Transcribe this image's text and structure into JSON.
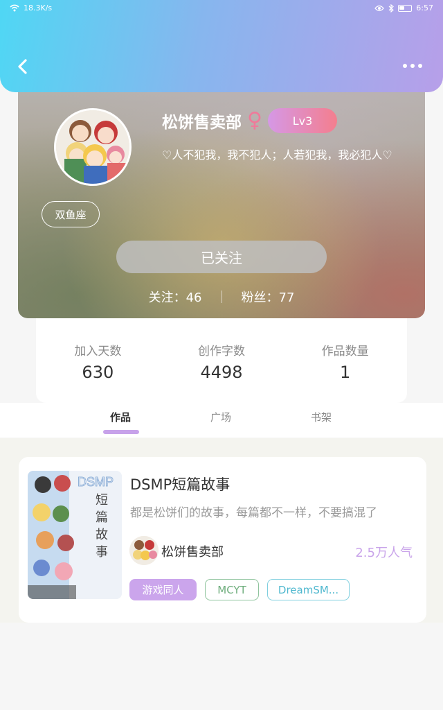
{
  "status_bar": {
    "network_speed": "18.3K/s",
    "time": "6:57"
  },
  "header": {
    "back_icon": "chevron-left-icon",
    "more_icon": "more-dots-icon"
  },
  "profile": {
    "nickname": "松饼售卖部",
    "gender_symbol": "♀",
    "level": "Lv3",
    "signature": "♡人不犯我，我不犯人；人若犯我，我必犯人♡",
    "zodiac": "双鱼座",
    "follow_button": "已关注",
    "following_label": "关注：46",
    "followers_label": "粉丝：77"
  },
  "stats": [
    {
      "label": "加入天数",
      "value": "630"
    },
    {
      "label": "创作字数",
      "value": "4498"
    },
    {
      "label": "作品数量",
      "value": "1"
    }
  ],
  "tabs": [
    {
      "label": "作品",
      "active": true
    },
    {
      "label": "广场",
      "active": false
    },
    {
      "label": "书架",
      "active": false
    }
  ],
  "book": {
    "title": "DSMP短篇故事",
    "description": "都是松饼们的故事，每篇都不一样，不要搞混了",
    "cover_title": "DSMP",
    "cover_subtitle": "短篇故事",
    "author": "松饼售卖部",
    "popularity": "2.5万人气",
    "tags": [
      "游戏同人",
      "MCYT",
      "DreamSM..."
    ]
  },
  "colors": {
    "accent": "#c7a2ea",
    "header_start": "#4fd7f4",
    "header_end": "#b79fe9"
  }
}
